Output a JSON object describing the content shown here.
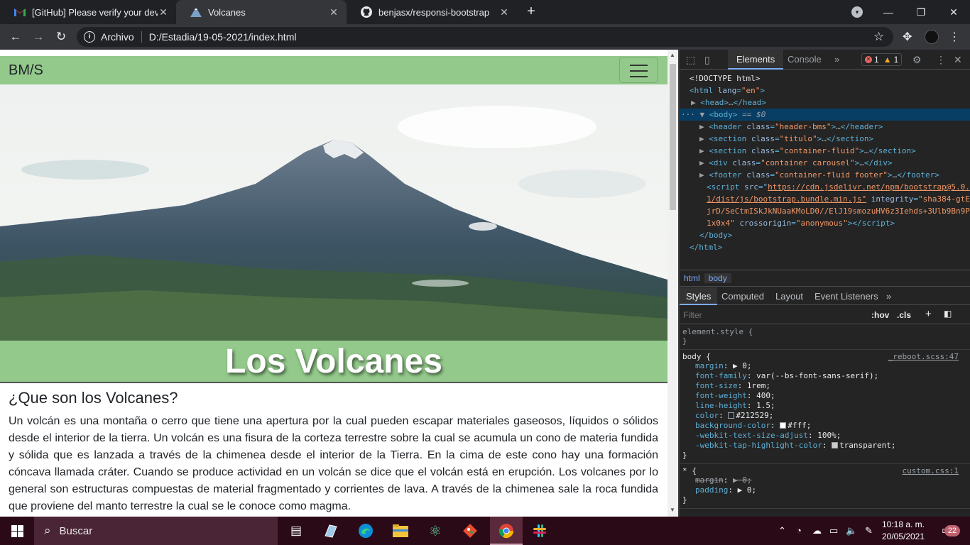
{
  "browser": {
    "tabs": [
      {
        "title": "[GitHub] Please verify your device",
        "icon": "gmail-icon"
      },
      {
        "title": "Volcanes",
        "icon": "volcano-favicon-icon"
      },
      {
        "title": "benjasx/responsi-bootstrap",
        "icon": "github-icon"
      }
    ],
    "close_glyph": "✕",
    "new_tab_glyph": "+",
    "url_prefix": "Archivo",
    "url": "D:/Estadia/19-05-2021/index.html"
  },
  "page": {
    "brand": "BM/S",
    "title": "Los Volcanes",
    "section_heading": "¿Que son los Volcanes?",
    "paragraph": "Un volcán es una montaña o cerro que tiene una apertura por la cual pueden escapar materiales gaseosos, líquidos o sólidos desde el interior de la tierra. Un volcán es una fisura de la corteza terrestre sobre la cual se acumula un cono de materia fundida y sólida que es lanzada a través de la chimenea desde el interior de la Tierra. En la cima de este cono hay una formación cóncava llamada cráter. Cuando se produce actividad en un volcán se dice que el volcán está en erupción. Los volcanes por lo general son estructuras compuestas de material fragmentado y corrientes de lava. A través de la chimenea sale la roca fundida que proviene del manto terrestre la cual se le conoce como magma.",
    "accent_color": "#93c98b"
  },
  "devtools": {
    "tabs": [
      "Elements",
      "Console"
    ],
    "more": "»",
    "error_count": "1",
    "warning_count": "1",
    "dom": {
      "doctype": "<!DOCTYPE html>",
      "html_open_tag": "html",
      "html_lang_attr": "lang",
      "html_lang_val": "\"en\"",
      "head": "head",
      "body": "body",
      "selected_marker": "== $0",
      "children": [
        {
          "tag": "header",
          "attr": "class",
          "val": "\"header-bms\""
        },
        {
          "tag": "section",
          "attr": "class",
          "val": "\"titulo\""
        },
        {
          "tag": "section",
          "attr": "class",
          "val": "\"container-fluid\""
        },
        {
          "tag": "div",
          "attr": "class",
          "val": "\"container carousel\""
        },
        {
          "tag": "footer",
          "attr": "class",
          "val": "\"container-fluid footer\""
        }
      ],
      "script_src": "https://cdn.jsdelivr.net/npm/bootstrap@5.0.",
      "script_src_2": "1/dist/js/bootstrap.bundle.min.js\"",
      "script_integrity": "\"sha384-gtE",
      "script_integrity_2": "jrD/SeCtmISkJkNUaaKMoLD0//ElJ19smozuHV6z3Iehds+3Ulb9Bn9P",
      "script_integrity_3": "1x0x4\"",
      "script_crossorigin": "\"anonymous\""
    },
    "breadcrumbs": [
      "html",
      "body"
    ],
    "style_tabs": [
      "Styles",
      "Computed",
      "Layout",
      "Event Listeners"
    ],
    "filter_placeholder": "Filter",
    "hov": ":hov",
    "cls": ".cls",
    "rules": {
      "element_style": "element.style {",
      "close": "}",
      "body_selector": "body {",
      "body_source": "_reboot.scss:47",
      "body_props": [
        {
          "name": "margin",
          "value": "▶ 0;"
        },
        {
          "name": "font-family",
          "value": "var(--bs-font-sans-serif);"
        },
        {
          "name": "font-size",
          "value": "1rem;"
        },
        {
          "name": "font-weight",
          "value": "400;"
        },
        {
          "name": "line-height",
          "value": "1.5;"
        },
        {
          "name": "color",
          "value": "#212529;"
        },
        {
          "name": "background-color",
          "value": "#fff;"
        },
        {
          "name": "-webkit-text-size-adjust",
          "value": "100%;"
        },
        {
          "name": "-webkit-tap-highlight-color",
          "value": "transparent;"
        }
      ],
      "star_selector": "* {",
      "star_source": "custom.css:1",
      "star_props": [
        {
          "name": "margin",
          "value": "▶ 0;"
        },
        {
          "name": "padding",
          "value": "▶ 0;"
        }
      ]
    }
  },
  "taskbar": {
    "search_placeholder": "Buscar",
    "time": "10:18 a. m.",
    "date": "20/05/2021",
    "notifications": "22"
  }
}
